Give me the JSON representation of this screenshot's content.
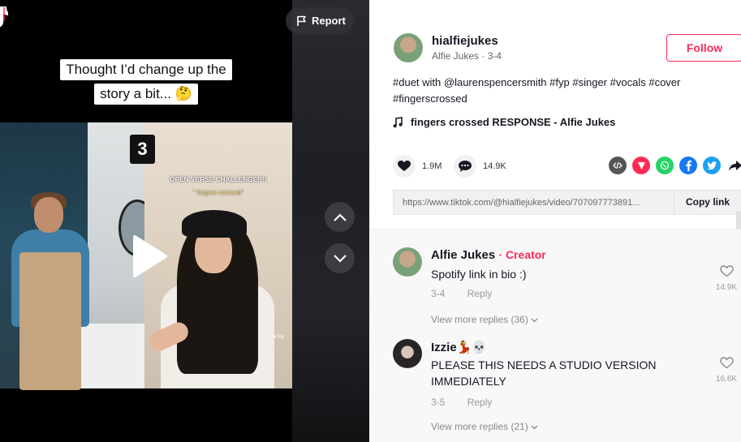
{
  "video": {
    "caption_line1": "Thought I’d change up the",
    "caption_line2": "story a bit... 🤔",
    "countdown": "3",
    "challenge_title": "OPEN VERSE CHALLENGE!!!!",
    "challenge_sub": "\" fingers crossed\"",
    "watermark": "TikTok",
    "report_label": "Report"
  },
  "author": {
    "username": "hialfiejukes",
    "nickname": "Alfie Jukes",
    "date": "3-4",
    "follow_label": "Follow"
  },
  "description": {
    "segments": [
      "#duet",
      " with ",
      "@laurenspencersmith",
      " ",
      "#fyp",
      " ",
      "#singer",
      " ",
      "#vocals",
      " ",
      "#cover",
      " ",
      "#fingerscrossed"
    ]
  },
  "music": {
    "title": "fingers crossed RESPONSE - Alfie Jukes"
  },
  "stats": {
    "likes": "1.9M",
    "comments": "14.9K"
  },
  "share": {
    "icons": [
      "embed-icon",
      "send-to-friends-icon",
      "whatsapp-icon",
      "facebook-icon",
      "twitter-icon",
      "share-arrow-icon"
    ],
    "colors": {
      "embed": "#555555",
      "send": "#fe2c55",
      "whatsapp": "#25d366",
      "facebook": "#1877f2",
      "twitter": "#1da1f2",
      "arrow": "#161823"
    }
  },
  "link": {
    "url": "https://www.tiktok.com/@hialfiejukes/video/707097773891...",
    "copy_label": "Copy link"
  },
  "comments": [
    {
      "name": "Alfie Jukes",
      "creator_tag": "· Creator",
      "text": "Spotify link in bio :)",
      "date": "3-4",
      "reply_label": "Reply",
      "likes": "14.9K",
      "more_replies": "View more replies (36)"
    },
    {
      "name": "Izzie💃💀",
      "creator_tag": "",
      "text": "PLEASE THIS NEEDS A STUDIO VERSION IMMEDIATELY",
      "date": "3-5",
      "reply_label": "Reply",
      "likes": "16.6K",
      "more_replies": "View more replies (21)"
    }
  ],
  "colors": {
    "accent": "#fe2c55",
    "text": "#161823"
  }
}
